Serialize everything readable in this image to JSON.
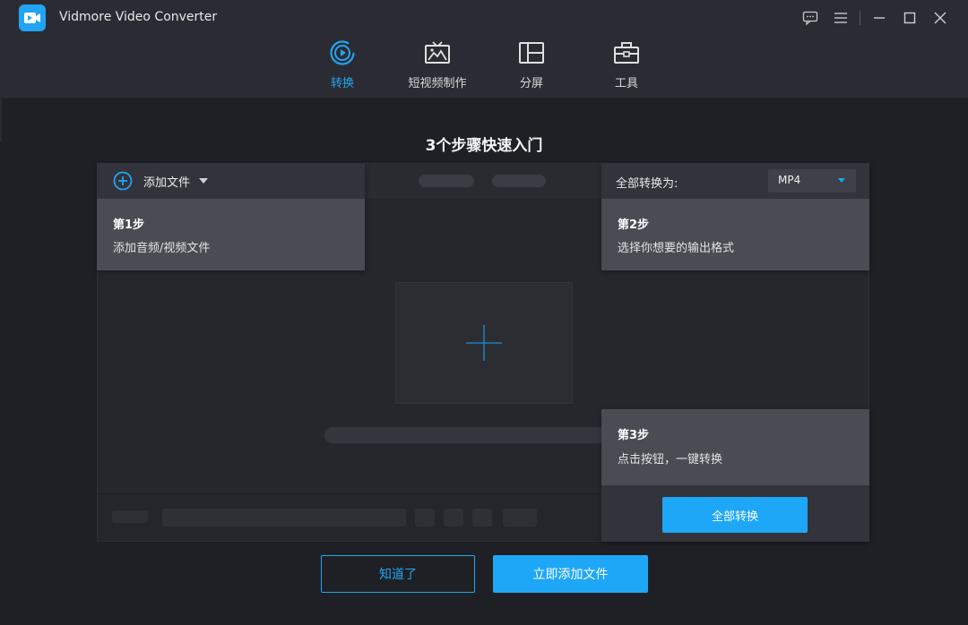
{
  "app": {
    "title": "Vidmore Video Converter"
  },
  "window_controls": {
    "icons": [
      "feedback-icon",
      "menu-icon",
      "minimize-icon",
      "maximize-icon",
      "close-icon"
    ]
  },
  "nav": {
    "items": [
      {
        "label": "转换",
        "icon": "convert-icon",
        "active": true
      },
      {
        "label": "短视频制作",
        "icon": "tv-icon",
        "active": false
      },
      {
        "label": "分屏",
        "icon": "split-screen-icon",
        "active": false
      },
      {
        "label": "工具",
        "icon": "toolbox-icon",
        "active": false
      }
    ]
  },
  "guide": {
    "headline": "3个步骤快速入门",
    "add_files_label": "添加文件",
    "step1": {
      "title": "第1步",
      "desc": "添加音频/视频文件"
    },
    "convert_to_label": "全部转换为:",
    "format_value": "MP4",
    "step2": {
      "title": "第2步",
      "desc": "选择你想要的输出格式"
    },
    "step3": {
      "title": "第3步",
      "desc": "点击按钮，一键转换"
    },
    "convert_all_button": "全部转换"
  },
  "footer": {
    "got_it_button": "知道了",
    "add_now_button": "立即添加文件"
  },
  "colors": {
    "accent": "#1ea7f6",
    "background": "#1f2025",
    "card": "#4a4b53"
  }
}
